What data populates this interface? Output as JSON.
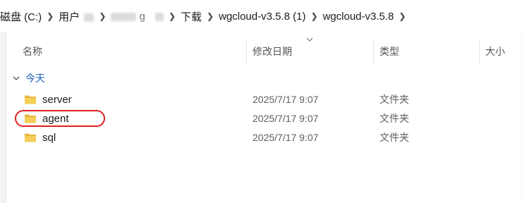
{
  "breadcrumb": {
    "items": [
      {
        "label": "磁盘 (C:)"
      },
      {
        "label": "用户"
      },
      {
        "label": "g"
      },
      {
        "label": "下载"
      },
      {
        "label": "wgcloud-v3.5.8 (1)"
      },
      {
        "label": "wgcloud-v3.5.8"
      }
    ]
  },
  "columns": {
    "name": "名称",
    "modified": "修改日期",
    "type": "类型",
    "size": "大小"
  },
  "group": {
    "label": "今天"
  },
  "files": [
    {
      "name": "server",
      "modified": "2025/7/17 9:07",
      "type": "文件夹"
    },
    {
      "name": "agent",
      "modified": "2025/7/17 9:07",
      "type": "文件夹"
    },
    {
      "name": "sql",
      "modified": "2025/7/17 9:07",
      "type": "文件夹"
    }
  ],
  "icons": {
    "folder": "folder-icon",
    "separator": "chevron-right-icon",
    "group_toggle": "chevron-down-icon",
    "sort": "chevron-down-icon"
  },
  "colors": {
    "folder": "#f3c64a",
    "group_label": "#1f5fb8",
    "annotation": "#e02020"
  }
}
